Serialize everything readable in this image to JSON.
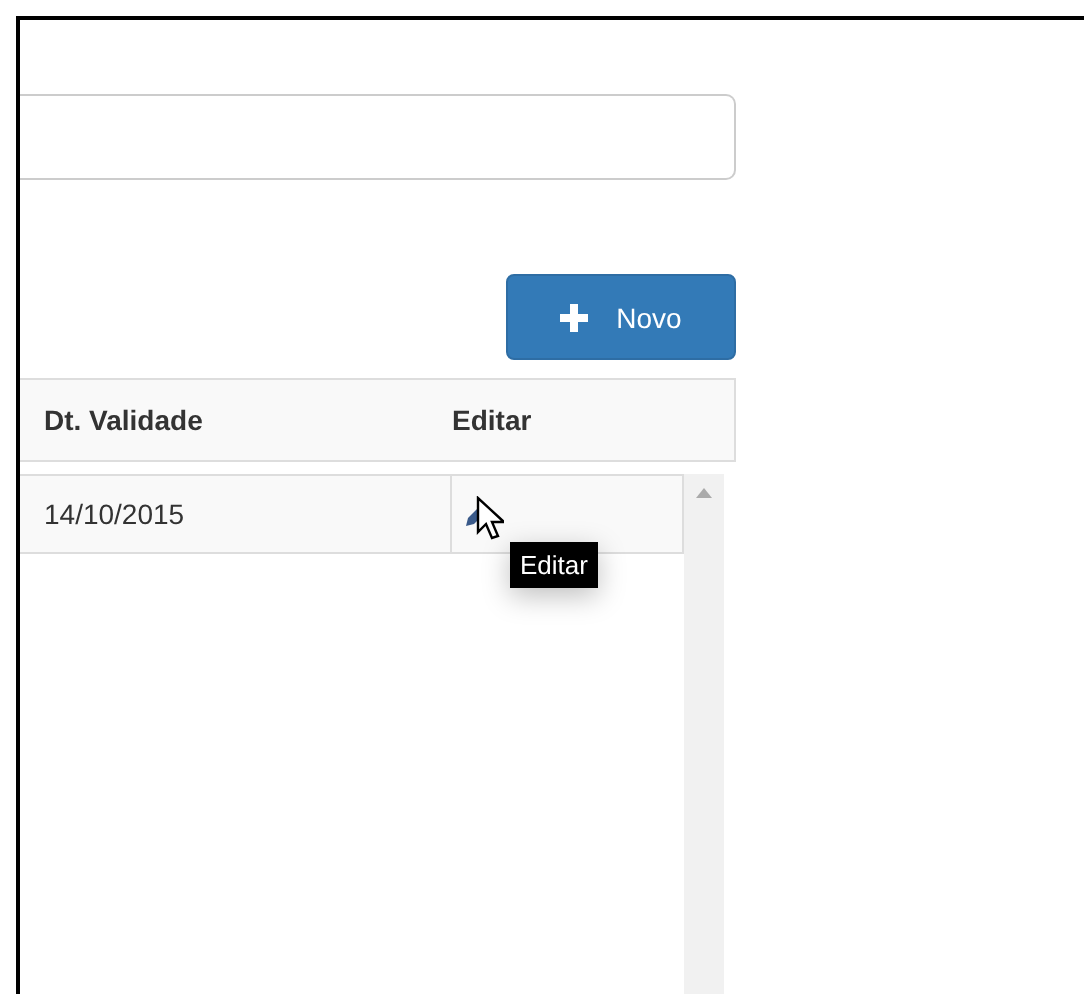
{
  "new_button": {
    "label": "Novo"
  },
  "table": {
    "columns": [
      "Dt. Validade",
      "Editar"
    ],
    "rows": [
      {
        "cells": [
          "14/10/2015"
        ]
      }
    ]
  },
  "tooltip": {
    "text": "Editar"
  }
}
